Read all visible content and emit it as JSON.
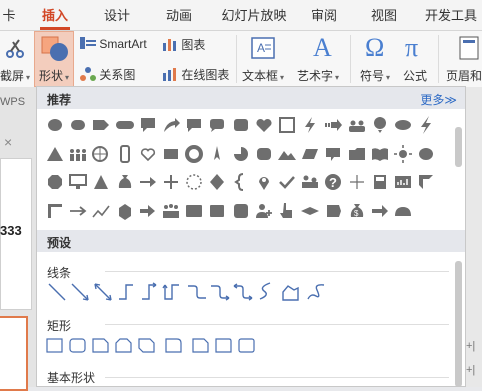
{
  "tabs": [
    {
      "label": "卡",
      "active": false
    },
    {
      "label": "插入",
      "active": true
    },
    {
      "label": "设计",
      "active": false
    },
    {
      "label": "动画",
      "active": false
    },
    {
      "label": "幻灯片放映",
      "active": false
    },
    {
      "label": "审阅",
      "active": false
    },
    {
      "label": "视图",
      "active": false
    },
    {
      "label": "开发工具",
      "active": false
    }
  ],
  "ribbon": {
    "screenshot_label": "截屏",
    "shape_label": "形状",
    "smartart_label": "SmartArt",
    "chart_label": "图表",
    "relation_label": "关系图",
    "online_chart_label": "在线图表",
    "textbox_label": "文本框",
    "arttext_label": "艺术字",
    "symbol_label": "符号",
    "formula_label": "公式",
    "header_label": "页眉和"
  },
  "left": {
    "wps_label": "WPS",
    "doc_number": "333"
  },
  "panel": {
    "recommended_title": "推荐",
    "more_link": "更多≫",
    "preset_title": "预设",
    "lines_title": "线条",
    "rect_title": "矩形",
    "basic_title": "基本形状"
  },
  "accent_color": "#d24726",
  "link_color": "#2e6bc5",
  "shape_icons": [
    "ellipse",
    "rounded-rect",
    "pentagon-arrow",
    "capsule",
    "callout",
    "curved-arrow",
    "speech-bubble",
    "rounded-speech",
    "rounded-square",
    "heart",
    "square-outline",
    "lightning",
    "striped-arrow",
    "people-group",
    "balloon",
    "oval",
    "lightning-2",
    "triangle",
    "people-row",
    "globe-people",
    "phone",
    "heart-outline",
    "rectangle",
    "donut",
    "compass-star",
    "pie-chart",
    "rounded-rect-2",
    "mountain",
    "parallelogram",
    "cylinder-callout",
    "folder",
    "open-book",
    "sun",
    "ellipse-2",
    "octagon",
    "monitor",
    "triangle-2",
    "money-bag",
    "arrow-right",
    "plus",
    "circle-dashed",
    "diamond",
    "brace-left",
    "map-pin",
    "check",
    "people-meeting",
    "question",
    "plus-thin",
    "trash",
    "chart-board",
    "l-shape",
    "corner",
    "long-arrow",
    "line-chart",
    "cube",
    "arrow-bold",
    "crowd",
    "screen",
    "hexagon-rect",
    "rounded-square-2",
    "person-add",
    "hand-pointer",
    "rhombus-wide",
    "cylinder",
    "dollar-bag",
    "arrow-circle",
    "cloud-half"
  ]
}
